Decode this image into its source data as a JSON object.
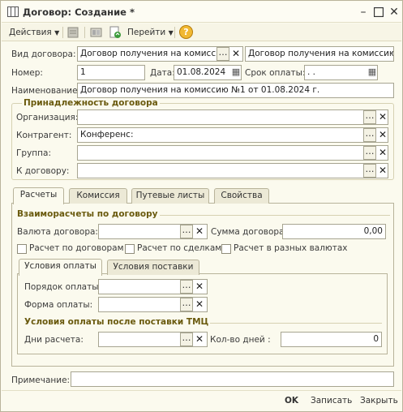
{
  "window": {
    "title": "Договор: Создание *"
  },
  "toolbar": {
    "actions": "Действия",
    "goto": "Перейти",
    "help": "?"
  },
  "form": {
    "kind_label": "Вид договора:",
    "kind_value": "Договор получения на комиссию",
    "kind_value2": "Договор получения на комиссию",
    "number_label": "Номер:",
    "number_value": "1",
    "date_label": "Дата:",
    "date_value": "01.08.2024",
    "due_label": "Срок оплаты:",
    "due_value": " .  .",
    "name_label": "Наименование:",
    "name_value": "Договор получения на комиссию №1 от 01.08.2024 г.",
    "belong_section": "Принадлежность договора",
    "org_label": "Организация:",
    "org_value": "",
    "contractor_label": "Контрагент:",
    "contractor_value": "Конференс:",
    "group_label": "Группа:",
    "group_value": "",
    "tocontract_label": "К договору:",
    "tocontract_value": ""
  },
  "tabs": [
    "Расчеты",
    "Комиссия",
    "Путевые листы",
    "Свойства"
  ],
  "calc": {
    "section": "Взаиморасчеты по договору",
    "currency_label": "Валюта договора:",
    "currency_value": "",
    "sum_label": "Сумма договора:",
    "sum_value": "0,00",
    "cb1": "Расчет по договорам",
    "cb2": "Расчет по сделкам",
    "cb3": "Расчет в разных валютах"
  },
  "subtabs": [
    "Условия оплаты",
    "Условия поставки"
  ],
  "pay": {
    "order_label": "Порядок оплаты:",
    "order_value": "",
    "form_label": "Форма оплаты:",
    "form_value": "",
    "after_section": "Условия оплаты после поставки ТМЦ",
    "days_label": "Дни расчета:",
    "days_value": "",
    "count_label": "Кол-во дней :",
    "count_value": "0"
  },
  "note": {
    "label": "Примечание:",
    "value": ""
  },
  "buttons": {
    "ok": "OK",
    "save": "Записать",
    "close": "Закрыть"
  }
}
